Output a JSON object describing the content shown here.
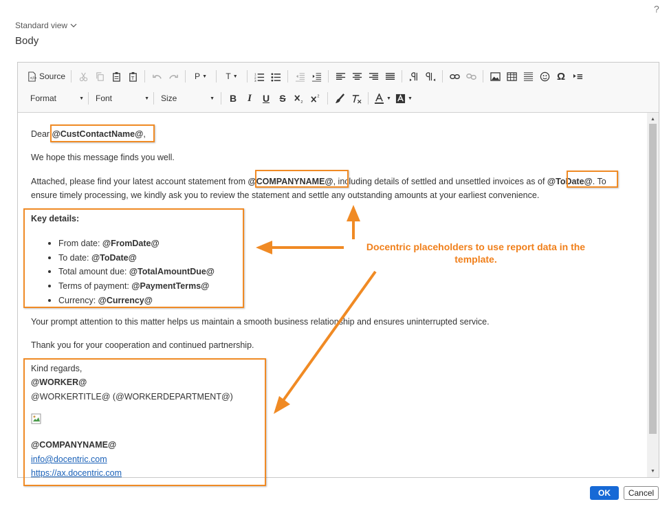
{
  "header": {
    "help": "?",
    "view_label": "Standard view",
    "section_title": "Body"
  },
  "toolbar": {
    "source_label": "Source",
    "paragraph_label": "P",
    "text_label": "T",
    "format_label": "Format",
    "font_label": "Font",
    "size_label": "Size",
    "bold": "B",
    "italic": "I",
    "underline": "U",
    "strike": "S",
    "omega": "Ω"
  },
  "email": {
    "greeting_prefix": "Dear ",
    "greeting_placeholder": "@CustContactName@",
    "greeting_suffix": ",",
    "line1": "We hope this message finds you well.",
    "line2_a": "Attached, please find your latest account statement from ",
    "line2_company": "@COMPANYNAME@",
    "line2_b": ", including details of settled and unsettled invoices as of ",
    "line2_date": "@ToDate@",
    "line2_c": ". To",
    "line3": "ensure timely processing, we kindly ask you to review the statement and settle any outstanding amounts at your earliest convenience.",
    "key_details": "Key details:",
    "bullets": [
      {
        "label": "From date: ",
        "value": "@FromDate@"
      },
      {
        "label": "To date: ",
        "value": "@ToDate@"
      },
      {
        "label": "Total amount due: ",
        "value": "@TotalAmountDue@"
      },
      {
        "label": "Terms of payment: ",
        "value": "@PaymentTerms@"
      },
      {
        "label": "Currency: ",
        "value": "@Currency@"
      }
    ],
    "line4": "Your prompt attention to this matter helps us maintain a smooth business relationship and ensures uninterrupted service.",
    "line5": "Thank you for your cooperation and continued partnership.",
    "regards": "Kind regards,",
    "worker": "@WORKER@",
    "worker_title": "@WORKERTITLE@ (@WORKERDEPARTMENT@)",
    "company": "@COMPANYNAME@",
    "email_link": "info@docentric.com",
    "web_link": "https://ax.docentric.com"
  },
  "annotation": {
    "text": "Docentric placeholders to use report data in the template.",
    "color": "#f07f1a"
  },
  "footer": {
    "ok_label": "OK",
    "cancel_label": "Cancel"
  }
}
